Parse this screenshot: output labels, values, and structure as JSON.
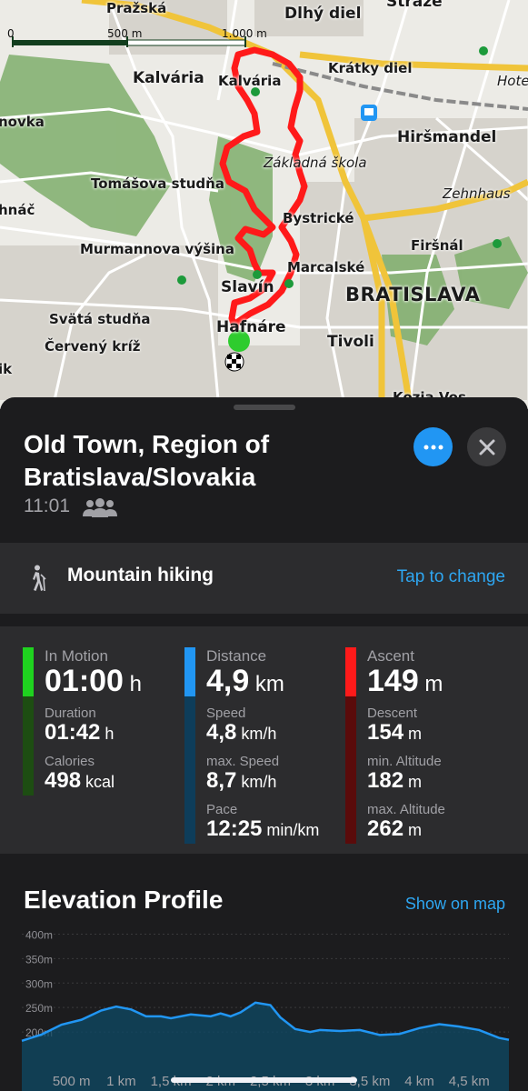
{
  "map": {
    "scale": {
      "left_label": "0",
      "mid_label": "500 m",
      "right_label": "1.000 m"
    },
    "labels": [
      {
        "text": "Pražská",
        "cls": "small"
      },
      {
        "text": "Dlhý diel",
        "cls": ""
      },
      {
        "text": "Stráže",
        "cls": ""
      },
      {
        "text": "Kalvária",
        "cls": ""
      },
      {
        "text": "Kalvária",
        "cls": "small"
      },
      {
        "text": "Krátky diel",
        "cls": "small"
      },
      {
        "text": "Hote",
        "cls": "italic"
      },
      {
        "text": "novka",
        "cls": "small"
      },
      {
        "text": "Hiršmandel",
        "cls": ""
      },
      {
        "text": "Základná škola",
        "cls": "italic"
      },
      {
        "text": "Tomášova studňa",
        "cls": "small"
      },
      {
        "text": "Zehnhaus",
        "cls": "italic"
      },
      {
        "text": "hnáč",
        "cls": "small"
      },
      {
        "text": "Bystrické",
        "cls": "small"
      },
      {
        "text": "Murmannova výšina",
        "cls": "small"
      },
      {
        "text": "Firšnál",
        "cls": "small"
      },
      {
        "text": "Marcalské",
        "cls": "small"
      },
      {
        "text": "Slavín",
        "cls": ""
      },
      {
        "text": "BRATISLAVA",
        "cls": "big"
      },
      {
        "text": "Svätá studňa",
        "cls": "small"
      },
      {
        "text": "Hafnáre",
        "cls": ""
      },
      {
        "text": "Červený kríž",
        "cls": "small"
      },
      {
        "text": "Tivoli",
        "cls": ""
      },
      {
        "text": "ik",
        "cls": "small"
      },
      {
        "text": "Kozia Vos",
        "cls": "small"
      }
    ]
  },
  "place": {
    "title": "Old Town, Region of Bratislava/Slovakia",
    "time": "11:01"
  },
  "activity": {
    "label": "Mountain hiking",
    "change": "Tap to change"
  },
  "stats": [
    {
      "color_top": "#1fd21f",
      "color_bottom": "#1d4d12",
      "main_label": "In Motion",
      "main_value": "01:00",
      "main_unit": "h",
      "rows": [
        {
          "label": "Duration",
          "value": "01:42",
          "unit": "h"
        },
        {
          "label": "Calories",
          "value": "498",
          "unit": "kcal"
        }
      ]
    },
    {
      "color_top": "#2196f3",
      "color_bottom": "#0e3d5a",
      "main_label": "Distance",
      "main_value": "4,9",
      "main_unit": "km",
      "rows": [
        {
          "label": "Speed",
          "value": "4,8",
          "unit": "km/h"
        },
        {
          "label": "max. Speed",
          "value": "8,7",
          "unit": "km/h"
        },
        {
          "label": "Pace",
          "value": "12:25",
          "unit": "min/km"
        }
      ]
    },
    {
      "color_top": "#ff1a1a",
      "color_bottom": "#5a0b0b",
      "main_label": "Ascent",
      "main_value": "149",
      "main_unit": "m",
      "rows": [
        {
          "label": "Descent",
          "value": "154",
          "unit": "m"
        },
        {
          "label": "min. Altitude",
          "value": "182",
          "unit": "m"
        },
        {
          "label": "max. Altitude",
          "value": "262",
          "unit": "m"
        }
      ]
    }
  ],
  "elevation": {
    "title": "Elevation Profile",
    "show_on_map": "Show on map",
    "y_labels": [
      "400m",
      "350m",
      "300m",
      "250m",
      "200m"
    ],
    "y_values": [
      400,
      350,
      300,
      250,
      200
    ],
    "x_labels": [
      "500 m",
      "1 km",
      "1,5 km",
      "2 km",
      "2,5 km",
      "3 km",
      "3,5 km",
      "4 km",
      "4,5 km"
    ],
    "x_values": [
      0.5,
      1,
      1.5,
      2,
      2.5,
      3,
      3.5,
      4,
      4.5
    ],
    "profile_km": [
      0,
      0.2,
      0.4,
      0.6,
      0.8,
      0.95,
      1.1,
      1.25,
      1.4,
      1.5,
      1.7,
      1.9,
      2.0,
      2.1,
      2.2,
      2.35,
      2.5,
      2.6,
      2.75,
      2.9,
      3.0,
      3.2,
      3.4,
      3.6,
      3.8,
      4.0,
      4.2,
      4.4,
      4.6,
      4.8,
      4.9
    ],
    "profile_m": [
      182,
      195,
      215,
      225,
      244,
      252,
      246,
      232,
      232,
      228,
      236,
      232,
      238,
      232,
      240,
      260,
      255,
      230,
      206,
      200,
      204,
      202,
      204,
      194,
      196,
      208,
      216,
      211,
      204,
      188,
      184
    ],
    "fill_color": "#0d4a66",
    "line_color": "#2196f3"
  }
}
